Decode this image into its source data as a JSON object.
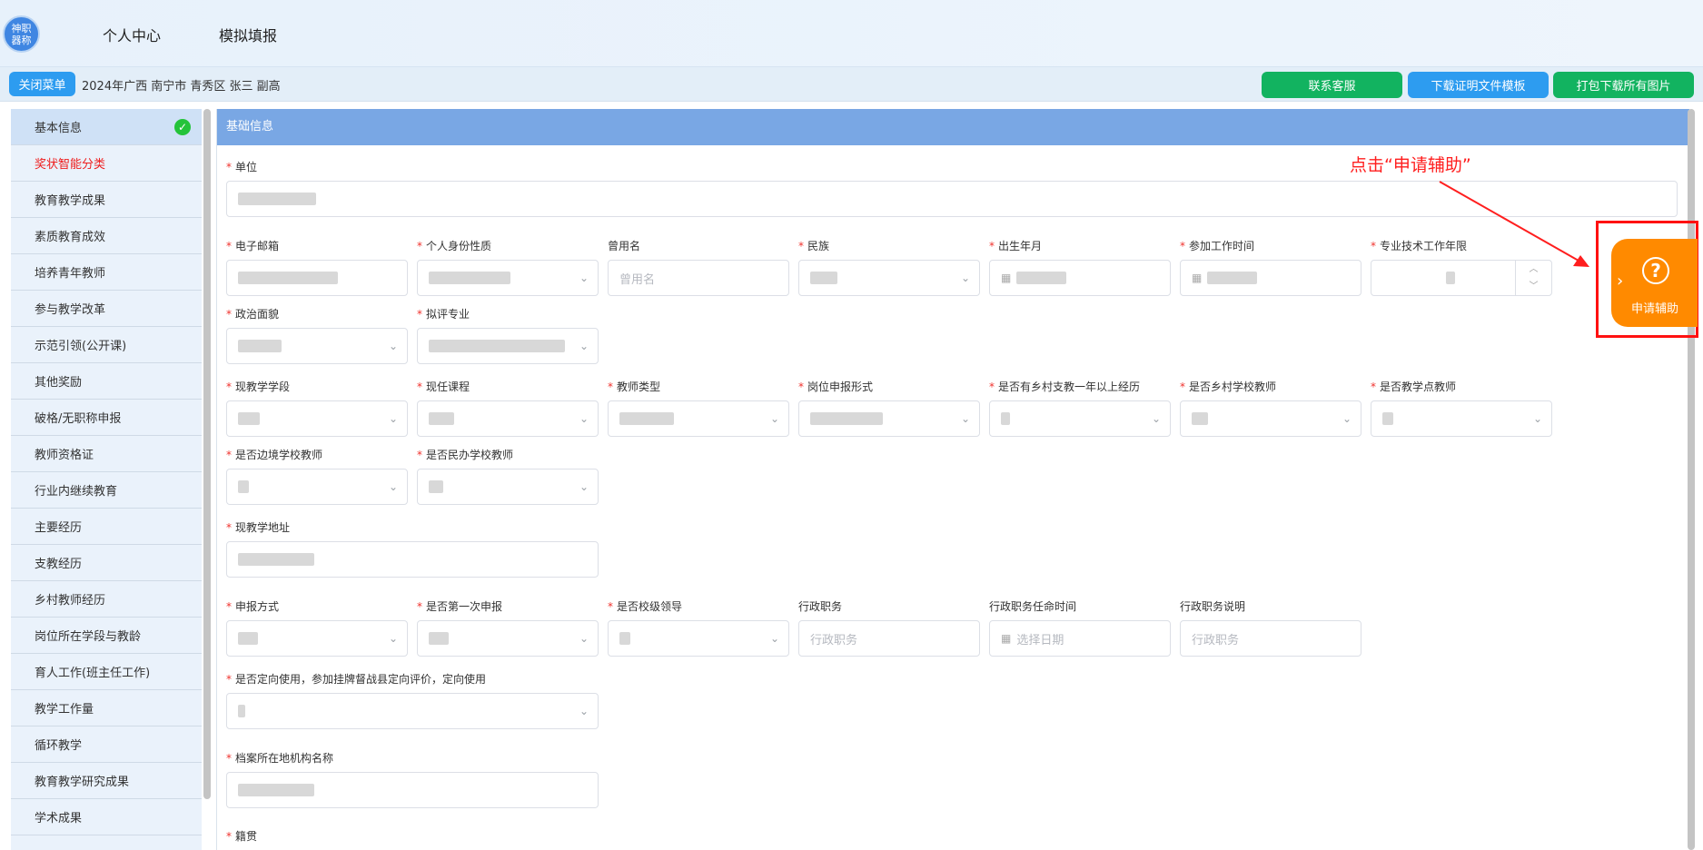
{
  "header": {
    "logo_text": "神职\n器称",
    "nav": [
      "个人中心",
      "模拟填报"
    ]
  },
  "subbar": {
    "close_menu": "关闭菜单",
    "breadcrumb": "2024年广西 南宁市 青秀区 张三 副高",
    "buttons": [
      "联系客服",
      "下载证明文件模板",
      "打包下载所有图片"
    ]
  },
  "sidebar": {
    "items": [
      "基本信息",
      "奖状智能分类",
      "教育教学成果",
      "素质教育成效",
      "培养青年教师",
      "参与教学改革",
      "示范引领(公开课)",
      "其他奖励",
      "破格/无职称申报",
      "教师资格证",
      "行业内继续教育",
      "主要经历",
      "支教经历",
      "乡村教师经历",
      "岗位所在学段与教龄",
      "育人工作(班主任工作)",
      "教学工作量",
      "循环教学",
      "教育教学研究成果",
      "学术成果"
    ]
  },
  "panel": {
    "title": "基础信息",
    "fields": {
      "unit": "单位",
      "email": "电子邮箱",
      "identity": "个人身份性质",
      "former_name": "曾用名",
      "former_name_ph": "曾用名",
      "ethnicity": "民族",
      "birth": "出生年月",
      "work_start": "参加工作时间",
      "tech_years": "专业技术工作年限",
      "politics": "政治面貌",
      "major": "拟评专业",
      "stage": "现教学学段",
      "course": "现任课程",
      "teacher_type": "教师类型",
      "post_form": "岗位申报形式",
      "rural_support": "是否有乡村支教一年以上经历",
      "rural_teacher": "是否乡村学校教师",
      "teach_point": "是否教学点教师",
      "border": "是否边境学校教师",
      "private": "是否民办学校教师",
      "address": "现教学地址",
      "apply_method": "申报方式",
      "first_apply": "是否第一次申报",
      "school_leader": "是否校级领导",
      "admin_post": "行政职务",
      "admin_post_ph": "行政职务",
      "admin_time": "行政职务任命时间",
      "admin_time_ph": "选择日期",
      "admin_desc": "行政职务说明",
      "admin_desc_ph": "行政职务",
      "directed": "是否定向使用，参加挂牌督战县定向评价，定向使用",
      "archive": "档案所在地机构名称",
      "native": "籍贯"
    }
  },
  "annotation": {
    "text": "点击“申请辅助”"
  },
  "help": {
    "label": "申请辅助",
    "icon_glyph": "?"
  }
}
